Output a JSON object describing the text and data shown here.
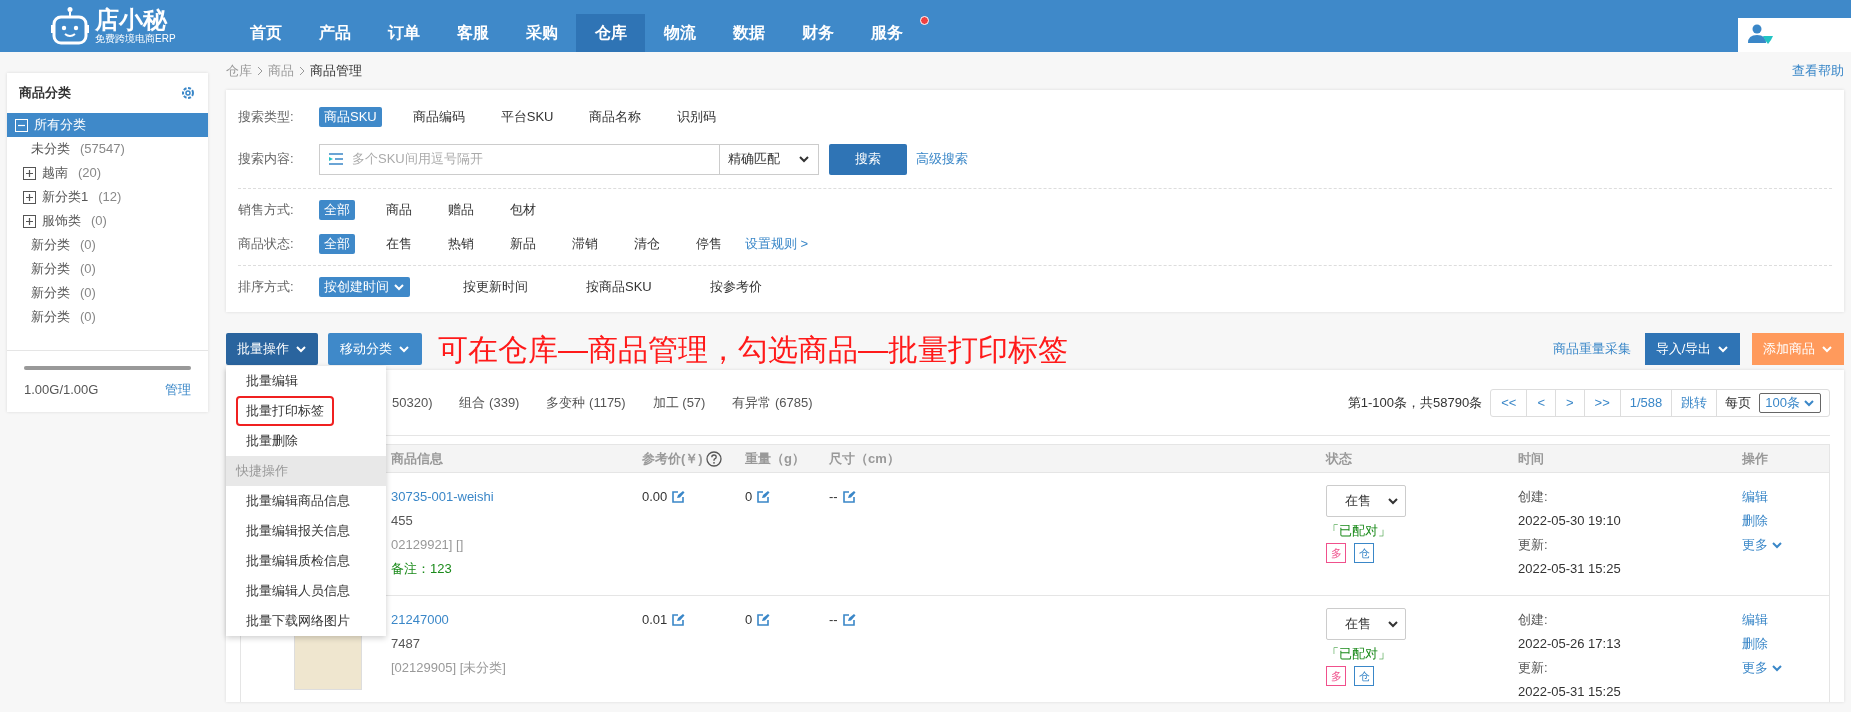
{
  "header": {
    "logo": {
      "name": "店小秘",
      "tagline": "免费跨境电商ERP"
    },
    "nav": [
      {
        "label": "首页",
        "selected": false,
        "notification": false
      },
      {
        "label": "产品",
        "selected": false,
        "notification": false
      },
      {
        "label": "订单",
        "selected": false,
        "notification": false
      },
      {
        "label": "客服",
        "selected": false,
        "notification": false
      },
      {
        "label": "采购",
        "selected": false,
        "notification": false
      },
      {
        "label": "仓库",
        "selected": true,
        "notification": false
      },
      {
        "label": "物流",
        "selected": false,
        "notification": false
      },
      {
        "label": "数据",
        "selected": false,
        "notification": false
      },
      {
        "label": "财务",
        "selected": false,
        "notification": false
      },
      {
        "label": "服务",
        "selected": false,
        "notification": true
      }
    ]
  },
  "sidebar": {
    "title": "商品分类",
    "tree": [
      {
        "label": "所有分类",
        "selected": true,
        "expanded": true,
        "children": [
          {
            "label": "未分类",
            "count": "(57547)",
            "selected": false
          },
          {
            "label": "越南",
            "count": "(20)",
            "selected": false,
            "expanded": false
          },
          {
            "label": "新分类1",
            "count": "(12)",
            "selected": false,
            "expanded": false
          },
          {
            "label": "服饰类",
            "count": "(0)",
            "selected": false,
            "expanded": false
          },
          {
            "label": "新分类",
            "count": "(0)",
            "selected": false
          },
          {
            "label": "新分类",
            "count": "(0)",
            "selected": false
          },
          {
            "label": "新分类",
            "count": "(0)",
            "selected": false
          },
          {
            "label": "新分类",
            "count": "(0)",
            "selected": false
          }
        ]
      }
    ],
    "storage": {
      "level": 1.0,
      "reading": "1.00G/1.00G",
      "manage": "管理"
    }
  },
  "breadcrumb": [
    "仓库",
    "商品",
    "商品管理"
  ],
  "help_link": "查看帮助",
  "search": {
    "type": {
      "label": "搜索类型:",
      "options": [
        {
          "label": "商品SKU",
          "selected": true
        },
        {
          "label": "商品编码",
          "selected": false
        },
        {
          "label": "平台SKU",
          "selected": false
        },
        {
          "label": "商品名称",
          "selected": false
        },
        {
          "label": "识别码",
          "selected": false
        }
      ]
    },
    "content": {
      "label": "搜索内容:",
      "placeholder": "多个SKU间用逗号隔开",
      "match": "精确匹配",
      "button": "搜索",
      "advanced": "高级搜索"
    },
    "sale_mode": {
      "label": "销售方式:",
      "options": [
        {
          "label": "全部",
          "selected": true
        },
        {
          "label": "商品",
          "selected": false
        },
        {
          "label": "赠品",
          "selected": false
        },
        {
          "label": "包材",
          "selected": false
        }
      ]
    },
    "status": {
      "label": "商品状态:",
      "options": [
        {
          "label": "全部",
          "selected": true
        },
        {
          "label": "在售",
          "selected": false
        },
        {
          "label": "热销",
          "selected": false
        },
        {
          "label": "新品",
          "selected": false
        },
        {
          "label": "滞销",
          "selected": false
        },
        {
          "label": "清仓",
          "selected": false
        },
        {
          "label": "停售",
          "selected": false
        }
      ],
      "rules_link": "设置规则 >"
    },
    "sort": {
      "label": "排序方式:",
      "options": [
        {
          "label": "按创建时间",
          "selected": true
        },
        {
          "label": "按更新时间",
          "selected": false
        },
        {
          "label": "按商品SKU",
          "selected": false
        },
        {
          "label": "按参考价",
          "selected": false
        }
      ]
    }
  },
  "toolbar": {
    "bulk": "批量操作",
    "move": "移动分类",
    "annotation": "可在仓库—商品管理，勾选商品—批量打印标签",
    "collect": "商品重量采集",
    "import_export": "导入/导出",
    "add": "添加商品"
  },
  "bulk_menu": [
    {
      "kind": "item",
      "label": "批量编辑",
      "highlighted": false
    },
    {
      "kind": "item",
      "label": "批量打印标签",
      "highlighted": true
    },
    {
      "kind": "item",
      "label": "批量删除",
      "highlighted": false
    },
    {
      "kind": "header",
      "label": "快捷操作"
    },
    {
      "kind": "item",
      "label": "批量编辑商品信息",
      "highlighted": false
    },
    {
      "kind": "item",
      "label": "批量编辑报关信息",
      "highlighted": false
    },
    {
      "kind": "item",
      "label": "批量编辑质检信息",
      "highlighted": false
    },
    {
      "kind": "item",
      "label": "批量编辑人员信息",
      "highlighted": false
    },
    {
      "kind": "item",
      "label": "批量下载网络图片",
      "highlighted": false
    }
  ],
  "tabs": [
    {
      "label": "50320)",
      "selected": false
    },
    {
      "label": "组合 (339)",
      "selected": false
    },
    {
      "label": "多变种 (1175)",
      "selected": false
    },
    {
      "label": "加工 (57)",
      "selected": false
    },
    {
      "label": "有异常 (6785)",
      "selected": false
    }
  ],
  "pagination": {
    "summary": "第1-100条，共58790条",
    "buttons": [
      "<<",
      "<",
      ">",
      ">>"
    ],
    "page": "1/588",
    "jump": "跳转",
    "per_page_label": "每页",
    "per_page": "100条"
  },
  "table": {
    "columns": [
      {
        "label": "商品信息"
      },
      {
        "label": "参考价(￥)",
        "help": true
      },
      {
        "label": "重量（g）"
      },
      {
        "label": "尺寸（cm）"
      },
      {
        "label": "状态"
      },
      {
        "label": "时间"
      },
      {
        "label": "操作"
      }
    ],
    "rows": [
      {
        "sku": "30735-001-weishi",
        "lines": [
          "455",
          "02129921] []"
        ],
        "note": "备注：123",
        "price": "0.00",
        "weight": "0",
        "size": "--",
        "status": "在售",
        "paired": "「已配对」",
        "tags": [
          {
            "label": "多",
            "color": "#f0508c"
          },
          {
            "label": "仓",
            "color": "#3a87c8"
          }
        ],
        "created_label": "创建:",
        "created": "2022-05-30 19:10",
        "updated_label": "更新:",
        "updated": "2022-05-31 15:25",
        "actions": [
          "编辑",
          "删除"
        ],
        "more": "更多"
      },
      {
        "sku": "21247000",
        "lines": [
          "7487",
          "[02129905] [未分类]"
        ],
        "thumbnail": true,
        "price": "0.01",
        "weight": "0",
        "size": "--",
        "status": "在售",
        "paired": "「已配对」",
        "tags": [
          {
            "label": "多",
            "color": "#f0508c"
          },
          {
            "label": "仓",
            "color": "#3a87c8"
          }
        ],
        "created_label": "创建:",
        "created": "2022-05-26 17:13",
        "updated_label": "更新:",
        "updated": "2022-05-31 15:25",
        "actions": [
          "编辑",
          "删除"
        ],
        "more": "更多"
      }
    ]
  }
}
